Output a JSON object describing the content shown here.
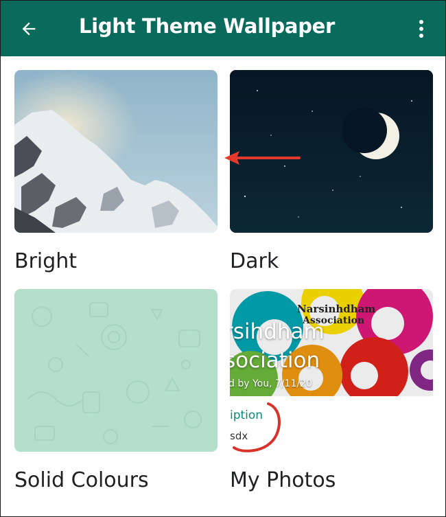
{
  "header": {
    "title": "Light Theme Wallpaper",
    "back_icon": "arrow-left-icon",
    "menu_icon": "more-vertical-icon",
    "color": "#0a6b5c"
  },
  "options": [
    {
      "label": "Bright"
    },
    {
      "label": "Dark"
    },
    {
      "label": "Solid Colours"
    },
    {
      "label": "My Photos"
    }
  ],
  "my_photos_preview": {
    "logo_line1": "Narsinhdham",
    "logo_line2": "Association",
    "title_line1": "rsihdham",
    "title_line2": "sociation",
    "byline": "d by You, 7/11/20",
    "description_label": "iption",
    "description_value": "sdx"
  },
  "annotation": {
    "arrow_color": "#e53a2b",
    "circle_color": "#d9322a"
  }
}
